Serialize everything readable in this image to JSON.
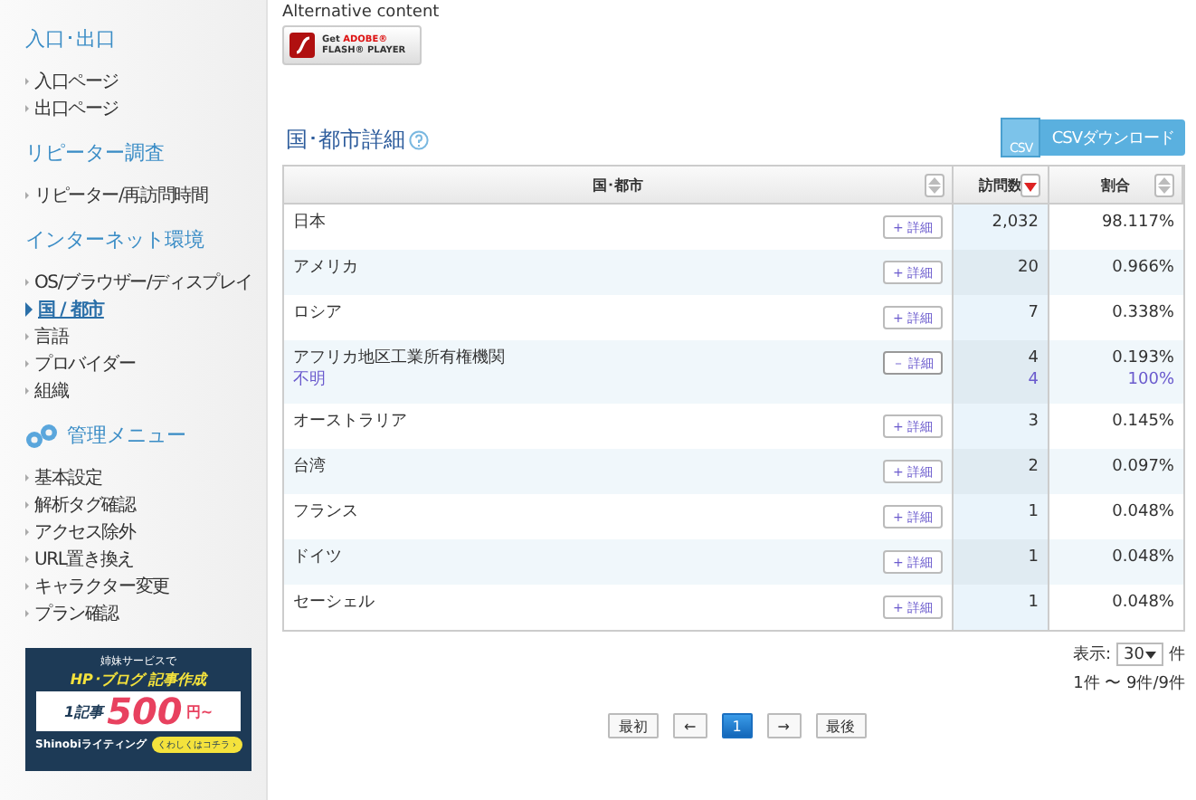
{
  "sidebar": {
    "sections": [
      {
        "title": "入口･出口",
        "icon": false,
        "items": [
          {
            "label": "入口ページ",
            "selected": false
          },
          {
            "label": "出口ページ",
            "selected": false
          }
        ]
      },
      {
        "title": "リピーター調査",
        "icon": false,
        "items": [
          {
            "label": "リピーター/再訪問時間",
            "selected": false
          }
        ]
      },
      {
        "title": "インターネット環境",
        "icon": false,
        "items": [
          {
            "label": "OS/ブラウザー/ディスプレイ",
            "selected": false
          },
          {
            "label": "国 / 都市",
            "selected": true
          },
          {
            "label": "言語",
            "selected": false
          },
          {
            "label": "プロバイダー",
            "selected": false
          },
          {
            "label": "組織",
            "selected": false
          }
        ]
      },
      {
        "title": "管理メニュー",
        "icon": true,
        "items": [
          {
            "label": "基本設定",
            "selected": false
          },
          {
            "label": "解析タグ確認",
            "selected": false
          },
          {
            "label": "アクセス除外",
            "selected": false
          },
          {
            "label": "URL置き換え",
            "selected": false
          },
          {
            "label": "キャラクター変更",
            "selected": false
          },
          {
            "label": "プラン確認",
            "selected": false
          }
        ]
      }
    ],
    "banner": {
      "lead": "姉妹サービスで",
      "headline": "HP･ブログ 記事作成",
      "unit": "1記事",
      "price": "500",
      "currency": "円~",
      "brand": "Shinobiライティング",
      "cta": "くわしくはコチラ ›"
    }
  },
  "flash": {
    "alt_text": "Alternative content",
    "get": "Get",
    "adobe": "ADOBE®",
    "player": "FLASH® PLAYER"
  },
  "section_title": "国･都市詳細",
  "csv_button": "CSVダウンロード",
  "csv_icon_label": "CSV",
  "table": {
    "columns": [
      {
        "label": "国･都市",
        "sorted": false
      },
      {
        "label": "訪問数",
        "sorted": true
      },
      {
        "label": "割合",
        "sorted": false
      }
    ],
    "rows": [
      {
        "name": "日本",
        "button": "+ 詳細",
        "visits": "2,032",
        "ratio": "98.117%",
        "expanded": false
      },
      {
        "name": "アメリカ",
        "button": "+ 詳細",
        "visits": "20",
        "ratio": "0.966%",
        "expanded": false
      },
      {
        "name": "ロシア",
        "button": "+ 詳細",
        "visits": "7",
        "ratio": "0.338%",
        "expanded": false
      },
      {
        "name": "アフリカ地区工業所有権機関",
        "button": "－ 詳細",
        "visits": "4",
        "ratio": "0.193%",
        "expanded": true,
        "children": [
          {
            "name": "不明",
            "visits": "4",
            "ratio": "100%"
          }
        ]
      },
      {
        "name": "オーストラリア",
        "button": "+ 詳細",
        "visits": "3",
        "ratio": "0.145%",
        "expanded": false
      },
      {
        "name": "台湾",
        "button": "+ 詳細",
        "visits": "2",
        "ratio": "0.097%",
        "expanded": false
      },
      {
        "name": "フランス",
        "button": "+ 詳細",
        "visits": "1",
        "ratio": "0.048%",
        "expanded": false
      },
      {
        "name": "ドイツ",
        "button": "+ 詳細",
        "visits": "1",
        "ratio": "0.048%",
        "expanded": false
      },
      {
        "name": "セーシェル",
        "button": "+ 詳細",
        "visits": "1",
        "ratio": "0.048%",
        "expanded": false
      }
    ]
  },
  "per_page": {
    "label": "表示:",
    "value": "30",
    "unit": "件"
  },
  "range": "1件 〜 9件/9件",
  "pagination": [
    {
      "label": "最初",
      "selected": false
    },
    {
      "label": "←",
      "selected": false
    },
    {
      "label": "1",
      "selected": true
    },
    {
      "label": "→",
      "selected": false
    },
    {
      "label": "最後",
      "selected": false
    }
  ]
}
